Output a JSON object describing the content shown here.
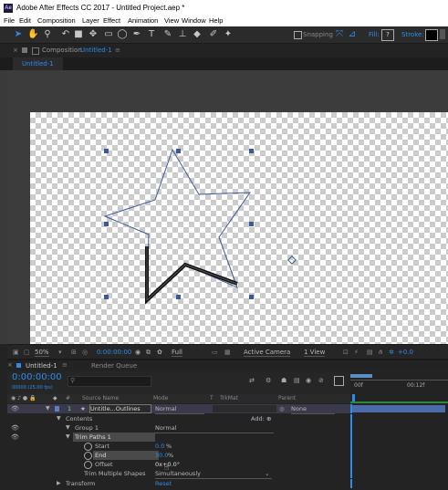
{
  "window": {
    "title": "Adobe After Effects CC 2017 - Untitled Project.aep *",
    "app_icon": "Ae"
  },
  "menu": [
    "File",
    "Edit",
    "Composition",
    "Layer",
    "Effect",
    "Animation",
    "View",
    "Window",
    "Help"
  ],
  "toolbar": {
    "tools": [
      "selection-tool",
      "hand-tool",
      "zoom-tool",
      "rotate-tool",
      "camera-tool",
      "pan-behind-tool",
      "rectangle-tool",
      "ellipse-tool",
      "pen-tool",
      "type-tool",
      "brush-tool",
      "clone-stamp-tool",
      "eraser-tool",
      "roto-brush-tool",
      "puppet-pin-tool"
    ],
    "snapping_label": "Snapping",
    "fill_label": "Fill:",
    "fill_value": "?",
    "stroke_label": "Stroke:"
  },
  "composition_panel": {
    "header_prefix": "Composition",
    "header_name": "Untitled-1",
    "tab_label": "Untitled-1"
  },
  "viewer_bar": {
    "zoom": "50%",
    "timecode": "0:00:00:00",
    "resolution": "Full",
    "camera": "Active Camera",
    "views": "1 View",
    "exposure": "+0.0"
  },
  "timeline": {
    "tab_label": "Untitled-1",
    "render_queue_label": "Render Queue",
    "timecode": "0:00:00:00",
    "frame_info": "00000 (25.00 fps)",
    "ruler_start": "00f",
    "ruler_end": "00:12f",
    "columns": {
      "hash": "#",
      "source_name": "Source Name",
      "mode": "Mode",
      "t": "T",
      "trkmat": "TrkMat",
      "parent": "Parent"
    },
    "layer": {
      "number": "1",
      "name": "Untitle...Outlines",
      "mode": "Normal",
      "parent": "None"
    },
    "contents_label": "Contents",
    "add_label": "Add:",
    "group_label": "Group 1",
    "group_mode": "Normal",
    "trim_label": "Trim Paths 1",
    "start_label": "Start",
    "start_value": "0.0",
    "start_unit": "%",
    "end_label": "End",
    "end_value": "30.0",
    "end_unit": "%",
    "offset_label": "Offset",
    "offset_value": "0x+0.0°",
    "trim_multiple_label": "Trim Multiple Shapes",
    "trim_multiple_value": "Simultaneously",
    "transform_label": "Transform",
    "reset_label": "Reset"
  },
  "colors": {
    "accent": "#2d8ceb",
    "shape_stroke": "#3c5a99",
    "trim_stroke": "#111111",
    "panel_bg": "#232323"
  }
}
